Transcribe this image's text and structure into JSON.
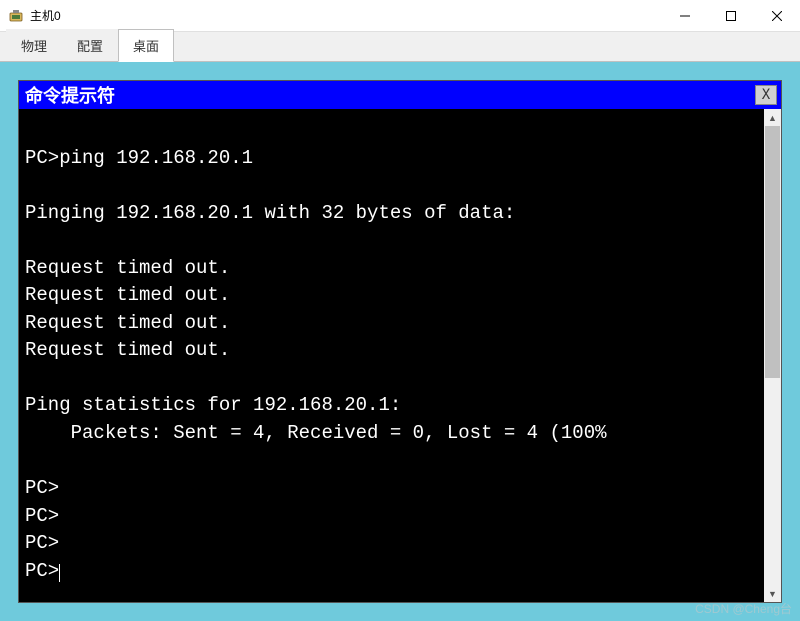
{
  "window": {
    "title": "主机0"
  },
  "tabs": {
    "physical": "物理",
    "config": "配置",
    "desktop": "桌面"
  },
  "terminal": {
    "title": "命令提示符",
    "close_label": "X",
    "lines": {
      "l0": "",
      "l1": "PC>ping 192.168.20.1",
      "l2": "",
      "l3": "Pinging 192.168.20.1 with 32 bytes of data:",
      "l4": "",
      "l5": "Request timed out.",
      "l6": "Request timed out.",
      "l7": "Request timed out.",
      "l8": "Request timed out.",
      "l9": "",
      "l10": "Ping statistics for 192.168.20.1:",
      "l11": "    Packets: Sent = 4, Received = 0, Lost = 4 (100%",
      "l12": "",
      "l13": "PC>",
      "l14": "PC>",
      "l15": "PC>",
      "l16": "PC>"
    }
  },
  "watermark": "CSDN @Cheng台"
}
